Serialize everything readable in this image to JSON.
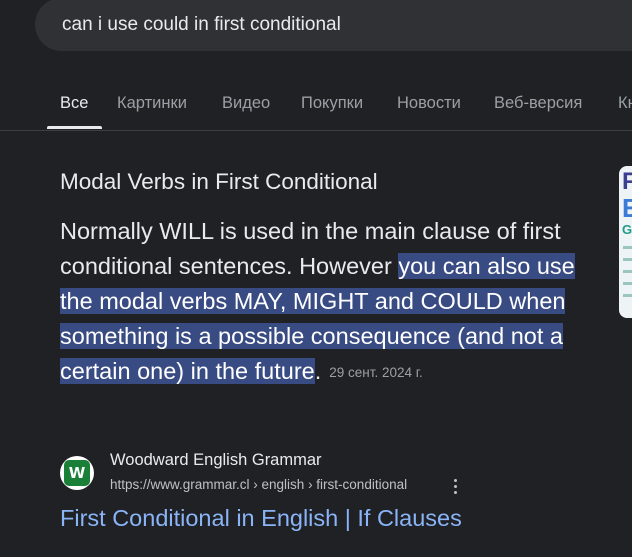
{
  "search": {
    "query": "can i use could in first conditional"
  },
  "tabs": [
    {
      "label": "Все",
      "active": true
    },
    {
      "label": "Картинки",
      "active": false
    },
    {
      "label": "Видео",
      "active": false
    },
    {
      "label": "Покупки",
      "active": false
    },
    {
      "label": "Новости",
      "active": false
    },
    {
      "label": "Веб-версия",
      "active": false
    },
    {
      "label": "Кн",
      "active": false
    }
  ],
  "snippet": {
    "heading": "Modal Verbs in First Conditional",
    "text_plain": "Normally WILL is used in the main clause of first conditional sentences. However ",
    "text_highlighted": "you can also use the modal verbs MAY, MIGHT and COULD when something is a possible consequence (and not a certain one) in the future",
    "text_end": ".",
    "date": "29 сент. 2024 г."
  },
  "source": {
    "favicon_letter": "W",
    "name": "Woodward English Grammar",
    "url": "https://www.grammar.cl › english › first-conditional",
    "link_title": "First Conditional in English | If Clauses"
  },
  "thumbnail": {
    "letters": [
      "F",
      "E",
      "GI"
    ]
  },
  "colors": {
    "background": "#202124",
    "search_bar": "#303134",
    "highlight": "#394b83",
    "link": "#8ab4f8"
  },
  "icons": {
    "more": "more-vert-icon",
    "favicon": "woodward-favicon-icon"
  }
}
